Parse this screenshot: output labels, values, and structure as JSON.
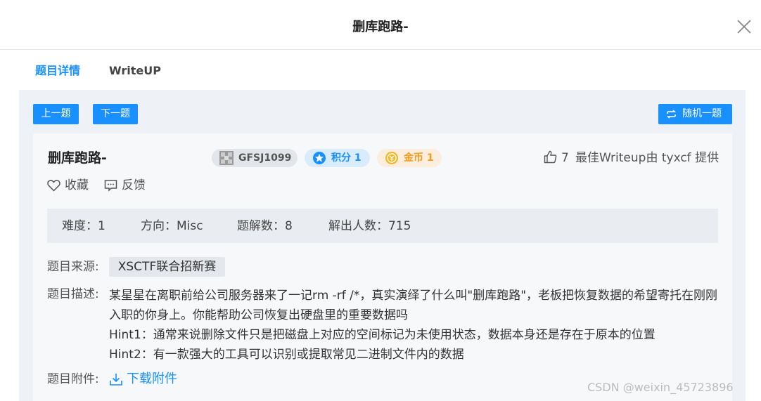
{
  "modal": {
    "title": "删库跑路-"
  },
  "tabs": [
    {
      "label": "题目详情",
      "active": true
    },
    {
      "label": "WriteUP",
      "active": false
    }
  ],
  "nav": {
    "prev_label": "上一题",
    "next_label": "下一题",
    "random_label": "随机一题"
  },
  "challenge": {
    "title": "删库跑路-",
    "id_badge": "GFSJ1099",
    "score_badge": "积分 1",
    "coin_badge": "金币 1",
    "likes": "7",
    "best_writeup": "最佳Writeup由 tyxcf 提供",
    "favorite_label": "收藏",
    "feedback_label": "反馈"
  },
  "stats": {
    "difficulty": "难度：1",
    "direction": "方向：Misc",
    "solves": "题解数：8",
    "solvers": "解出人数：715"
  },
  "details": {
    "source_label": "题目来源:",
    "source_value": "XSCTF联合招新赛",
    "desc_label": "题目描述:",
    "desc_line1": "某星星在离职前给公司服务器来了一记rm -rf /*，真实演绎了什么叫\"删库跑路\"，老板把恢复数据的希望寄托在刚刚入职的你身上。你能帮助公司恢复出硬盘里的重要数据吗",
    "desc_hint1": "Hint1：通常来说删除文件只是把磁盘上对应的空间标记为未使用状态，数据本身还是存在于原本的位置",
    "desc_hint2": "Hint2：有一款强大的工具可以识别或提取常见二进制文件内的数据",
    "attachment_label": "题目附件:",
    "download_label": "下载附件"
  },
  "watermark": "CSDN @weixin_45723896",
  "colors": {
    "accent": "#1890ff",
    "coin": "#f29d1c",
    "panel_bg": "#eef2f6"
  }
}
